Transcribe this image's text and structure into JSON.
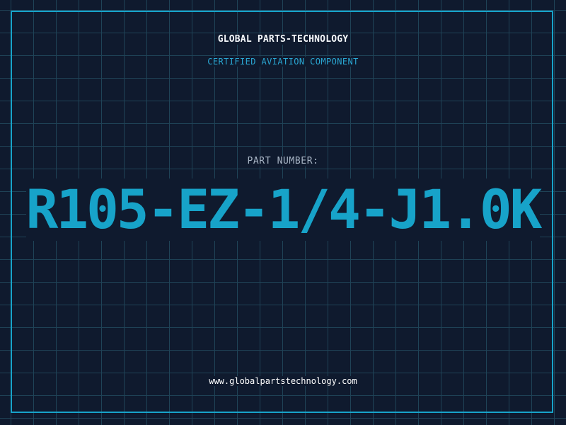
{
  "header": {
    "company_name": "GLOBAL PARTS-TECHNOLOGY",
    "tagline": "CERTIFIED AVIATION COMPONENT"
  },
  "part": {
    "label": "PART NUMBER:",
    "number": "R105-EZ-1/4-J1.0K"
  },
  "footer": {
    "website": "www.globalpartstechnology.com"
  },
  "colors": {
    "background": "#0f1a2e",
    "grid": "#1f4357",
    "accent": "#17a3c9",
    "title": "#f4f7fa",
    "label": "#a9b6c6"
  }
}
